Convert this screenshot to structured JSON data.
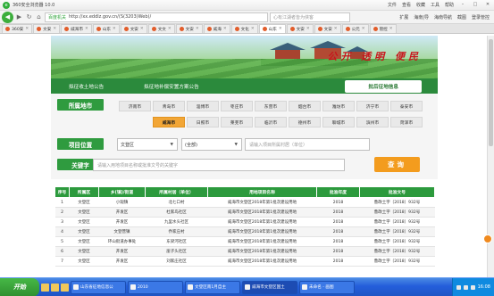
{
  "browser": {
    "title": "360安全浏览器 10.0",
    "menu": [
      "文件",
      "查看",
      "收藏",
      "工具",
      "帮助"
    ],
    "secure_label": "百度机关",
    "url": "http://xx.eddlz.gov.cn/(S(3203)Web)/",
    "search_placeholder": "心有江湖者皆为侠客",
    "addr_right": [
      "扩展",
      "海南|导",
      "海南导航",
      "截图",
      "登录管控"
    ],
    "tabs": [
      "360安",
      "文安",
      "威海市",
      "山东",
      "文安",
      "文文",
      "文安",
      "威海",
      "文化",
      "山东",
      "文安",
      "文安",
      "公元",
      "管控"
    ]
  },
  "header": {
    "slogan": "公开 透明 便民",
    "nav": [
      "拟征收土地公告",
      "拟征地补偿安置方案公告",
      "批后征地信息"
    ]
  },
  "filters": {
    "city_label": "所属地市",
    "cities": [
      "济南市",
      "青岛市",
      "淄博市",
      "枣庄市",
      "东营市",
      "烟台市",
      "潍坊市",
      "济宁市",
      "泰安市",
      "威海市",
      "日照市",
      "莱芜市",
      "临沂市",
      "德州市",
      "聊城市",
      "滨州市",
      "菏泽市"
    ],
    "active_city": "威海市",
    "location_label": "项目位置",
    "district_value": "文登区",
    "town_value": "(全部)",
    "village_placeholder": "请输入项目所属村居（单位）",
    "keyword_label": "关键字",
    "keyword_placeholder": "请输入用地项目名称或批准文号的关键字",
    "query_button": "查询"
  },
  "table": {
    "headers": [
      "序号",
      "所属区",
      "乡(镇)/街道",
      "所属村居（单位）",
      "用地项目名称",
      "批准年度",
      "批准文号"
    ],
    "rows": [
      [
        "1",
        "文登区",
        "小观镇",
        "北七口村",
        "威海市文登区2018年第1批次建设用地",
        "2018",
        "鲁政土字〔2018〕932号"
      ],
      [
        "2",
        "文登区",
        "开发区",
        "杜家岛社区",
        "威海市文登区2018年第1批次建设用地",
        "2018",
        "鲁政土字〔2018〕932号"
      ],
      [
        "3",
        "文登区",
        "开发区",
        "九里水头社区",
        "威海市文登区2018年第1批次建设用地",
        "2018",
        "鲁政土字〔2018〕932号"
      ],
      [
        "4",
        "文登区",
        "文登营镇",
        "乔家庄村",
        "威海市文登区2018年第1批次建设用地",
        "2018",
        "鲁政土字〔2018〕932号"
      ],
      [
        "5",
        "文登区",
        "环山街道办事处",
        "东梁河社区",
        "威海市文登区2018年第1批次建设用地",
        "2018",
        "鲁政土字〔2018〕932号"
      ],
      [
        "6",
        "文登区",
        "开发区",
        "崖子头社区",
        "威海市文登区2018年第1批次建设用地",
        "2018",
        "鲁政土字〔2018〕932号"
      ],
      [
        "7",
        "文登区",
        "开发区",
        "刘家庄社区",
        "威海市文登区2018年第1批次建设用地",
        "2018",
        "鲁政土字〔2018〕932号"
      ]
    ]
  },
  "taskbar": {
    "start": "开始",
    "items": [
      "山东省征地信息公",
      "2010",
      "文登区南1月自主",
      "威海市文登区国土",
      "未命名 - 画图"
    ],
    "clock": "16:08"
  }
}
